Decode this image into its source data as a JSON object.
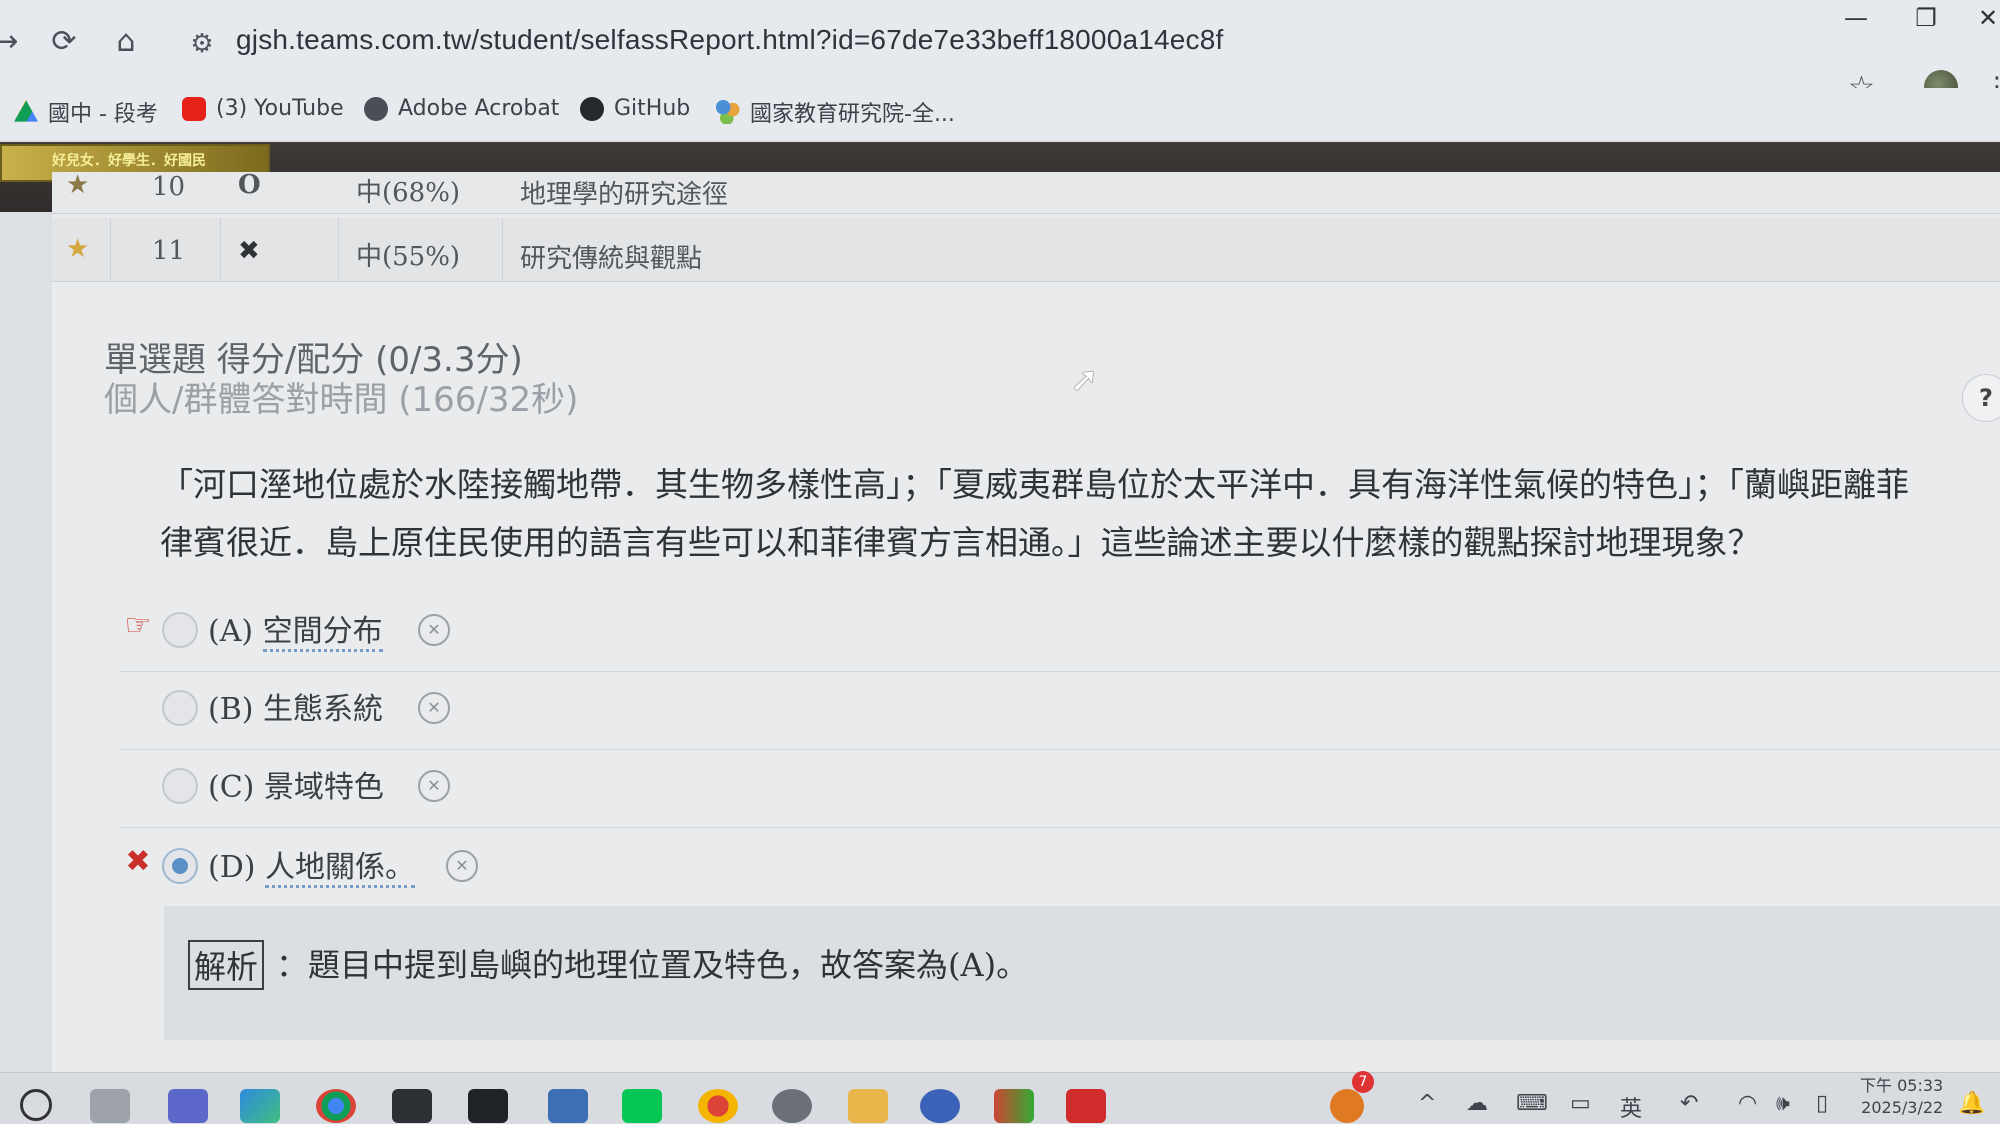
{
  "browser": {
    "url": "gjsh.teams.com.tw/student/selfassReport.html?id=67de7e33beff18000a14ec8f",
    "bookmarks": [
      "國中 - 段考",
      "(3) YouTube",
      "Adobe Acrobat",
      "GitHub",
      "國家教育研究院-全..."
    ]
  },
  "site": {
    "logo_text": "好兒女．好學生．好國民"
  },
  "table": {
    "rows": [
      {
        "no": "10",
        "result": "O",
        "difficulty": "中(68%)",
        "topic": "地理學的研究途徑"
      },
      {
        "no": "11",
        "result": "✖",
        "difficulty": "中(55%)",
        "topic": "研究傳統與觀點"
      }
    ]
  },
  "question": {
    "score_line": "單選題 得分/配分 (0/3.3分)",
    "time_line": "個人/群體答對時間 (166/32秒)",
    "line1": "「河口溼地位處於水陸接觸地帶．其生物多樣性高」；「夏威夷群島位於太平洋中．具有海洋性氣候的特色」；「蘭嶼距離菲",
    "line2": "律賓很近．島上原住民使用的語言有些可以和菲律賓方言相通。」這些論述主要以什麼樣的觀點探討地理現象？",
    "options": [
      {
        "letter": "(A)",
        "text": "空間分布"
      },
      {
        "letter": "(B)",
        "text": "生態系統"
      },
      {
        "letter": "(C)",
        "text": "景域特色"
      },
      {
        "letter": "(D)",
        "text": "人地關係。"
      }
    ],
    "explain_tag": "解析",
    "explain_text": "：題目中提到島嶼的地理位置及特色，故答案為(A)。"
  },
  "taskbar": {
    "clock_time": "下午 05:33",
    "clock_date": "2025/3/22",
    "ime": "英",
    "badge": "7"
  },
  "colors": {
    "correct_hand": "#d0453a",
    "wrong_mark": "#c9302c",
    "selected_radio": "#5b8fc7",
    "star": "#d4a640"
  }
}
